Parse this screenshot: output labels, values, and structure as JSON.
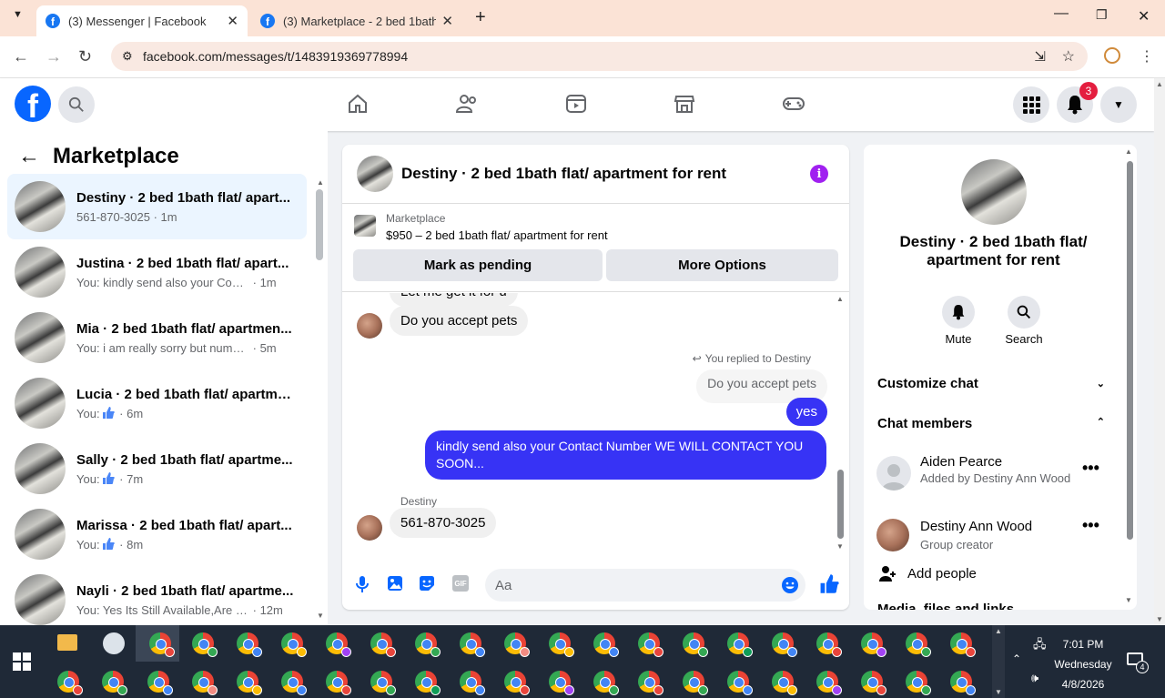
{
  "browser": {
    "tabs": [
      {
        "label": "(3) Messenger | Facebook",
        "active": true
      },
      {
        "label": "(3) Marketplace - 2 bed 1bath fl",
        "active": false
      }
    ],
    "url": "facebook.com/messages/t/1483919369778994"
  },
  "header": {
    "logo": "f",
    "notification_count": "3"
  },
  "sidebar": {
    "title": "Marketplace",
    "conversations": [
      {
        "name": "Destiny · 2 bed 1bath flat/ apart...",
        "preview": "561-870-3025",
        "time": "1m",
        "selected": true
      },
      {
        "name": "Justina · 2 bed 1bath flat/ apart...",
        "preview": "You: kindly send also your Contact ...",
        "time": "1m"
      },
      {
        "name": "Mia · 2 bed 1bath flat/ apartmen...",
        "preview": "You: i am really sorry but number a...",
        "time": "5m"
      },
      {
        "name": "Lucia · 2 bed 1bath flat/ apartme...",
        "preview": "You:",
        "time": "6m",
        "thumb": true
      },
      {
        "name": "Sally · 2 bed 1bath flat/ apartme...",
        "preview": "You:",
        "time": "7m",
        "thumb": true
      },
      {
        "name": "Marissa · 2 bed 1bath flat/ apart...",
        "preview": "You:",
        "time": "8m",
        "thumb": true
      },
      {
        "name": "Nayli · 2 bed 1bath flat/ apartme...",
        "preview": "You: Yes Its Still Available,Are you ...",
        "time": "12m"
      }
    ]
  },
  "chat": {
    "title": "Destiny · 2 bed 1bath flat/ apartment for rent",
    "listing_label": "Marketplace",
    "listing_text": "$950 – 2 bed 1bath flat/ apartment for rent",
    "mark_pending": "Mark as pending",
    "more_options": "More Options",
    "partial_msg": "Let me get it for u",
    "msg_pets": "Do you accept pets",
    "replied_label": "You replied to Destiny",
    "quoted": "Do you accept pets",
    "msg_yes": "yes",
    "msg_contact": "kindly send also your Contact Number  WE WILL CONTACT YOU SOON...",
    "sender_name": "Destiny",
    "msg_number": "561-870-3025",
    "input_placeholder": "Aa",
    "gif_label": "GIF"
  },
  "details": {
    "title": "Destiny · 2 bed 1bath flat/ apartment for rent",
    "mute_label": "Mute",
    "search_label": "Search",
    "customize": "Customize chat",
    "members_header": "Chat members",
    "members": [
      {
        "name": "Aiden Pearce",
        "sub": "Added by Destiny Ann Wood"
      },
      {
        "name": "Destiny Ann Wood",
        "sub": "Group creator"
      }
    ],
    "add_people": "Add people",
    "media_partial": "Media, files and links"
  },
  "taskbar": {
    "time": "7:01 PM",
    "day": "Wednesday",
    "date": "4/8/2026",
    "notif_count": "4"
  },
  "colors": {
    "fb_blue": "#0866ff",
    "bubble_blue": "#3733f5",
    "accent_purple": "#a020f0"
  }
}
